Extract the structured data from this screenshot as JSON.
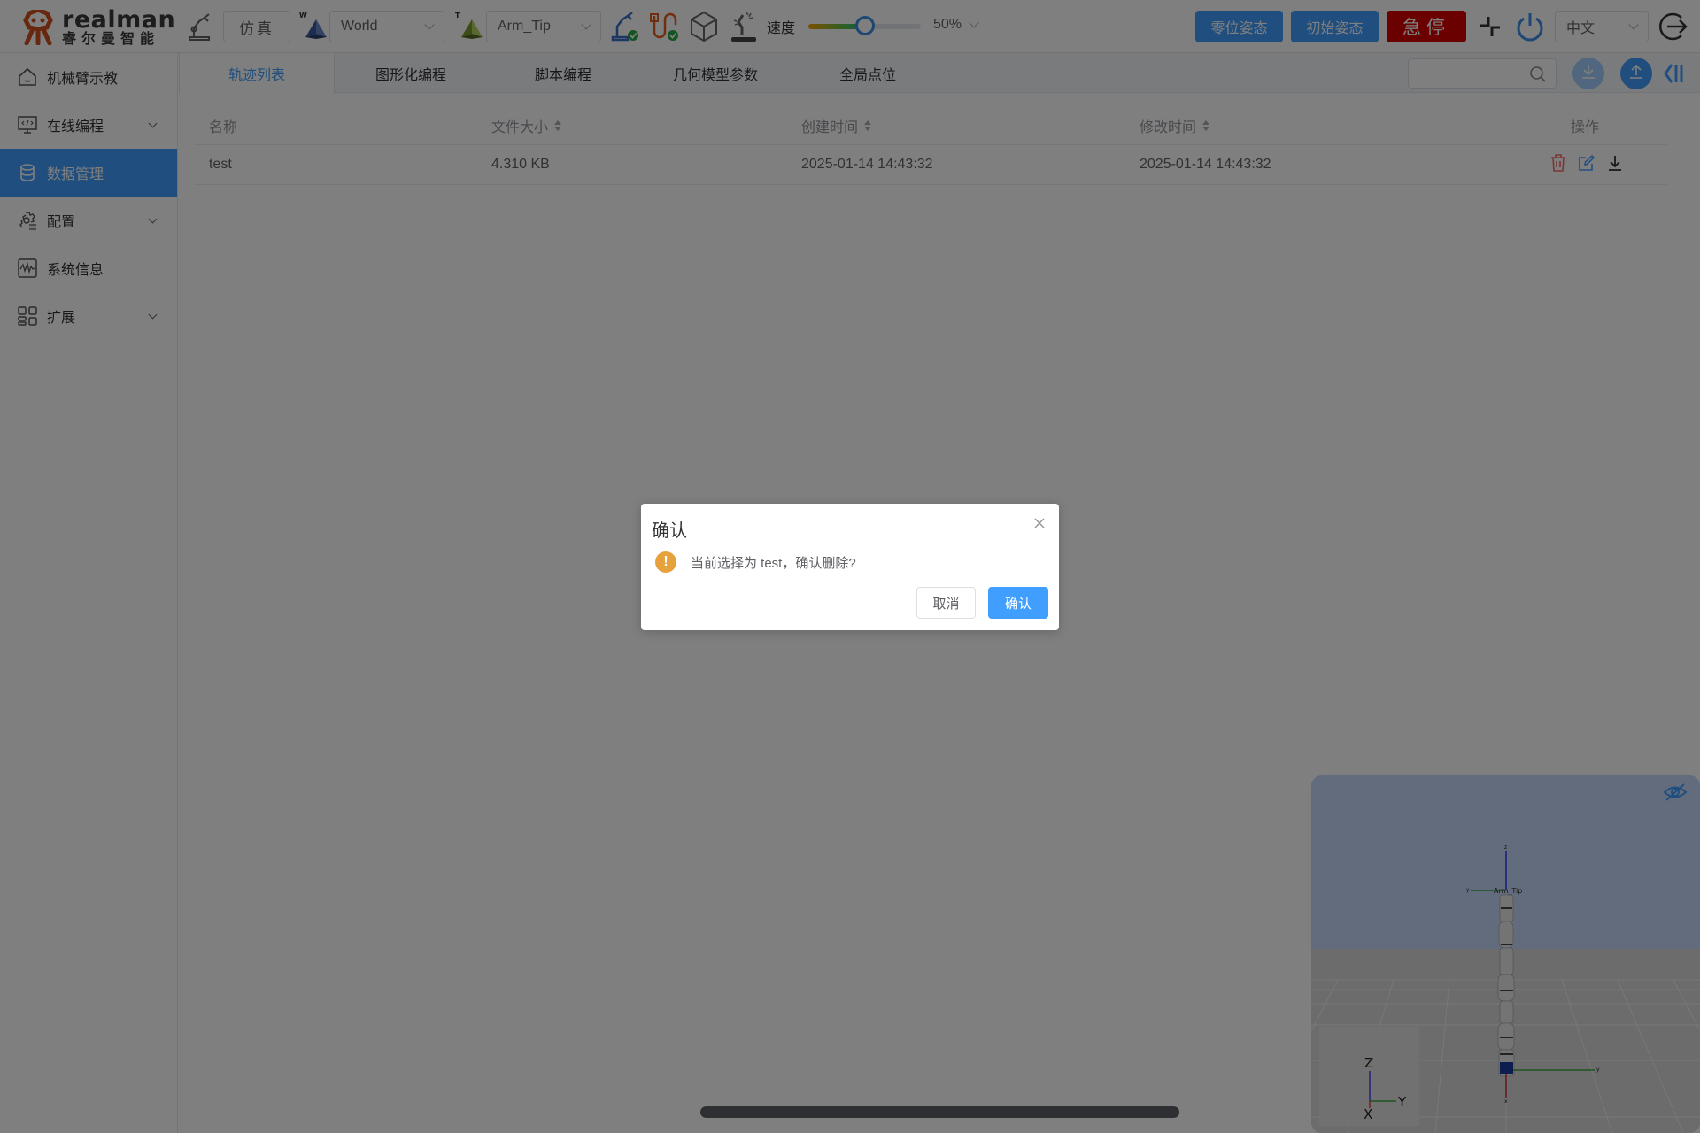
{
  "app": {
    "logo_en": "realman",
    "logo_cn": "睿尔曼智能"
  },
  "toolbar": {
    "mode_button": "仿真",
    "work_frame": {
      "label_letter": "W",
      "value": "World"
    },
    "tool_frame": {
      "label_letter": "T",
      "value": "Arm_Tip"
    },
    "speed_label": "速度",
    "speed_value": "50%",
    "speed_fraction": 0.5,
    "zero_pose_button": "零位姿态",
    "init_pose_button": "初始姿态",
    "estop_button": "急停",
    "language": "中文",
    "icons": [
      "robot-arm-icon",
      "arm-connected-icon",
      "io-connected-icon",
      "cube-model-icon",
      "teach-mode-icon",
      "collapse-icon",
      "power-icon",
      "logout-icon"
    ]
  },
  "sidebar": {
    "items": [
      {
        "label": "机械臂示教",
        "icon": "home-icon",
        "expandable": false,
        "active": false
      },
      {
        "label": "在线编程",
        "icon": "code-monitor-icon",
        "expandable": true,
        "active": false
      },
      {
        "label": "数据管理",
        "icon": "database-icon",
        "expandable": false,
        "active": true
      },
      {
        "label": "配置",
        "icon": "settings-icon",
        "expandable": true,
        "active": false
      },
      {
        "label": "系统信息",
        "icon": "pulse-icon",
        "expandable": false,
        "active": false
      },
      {
        "label": "扩展",
        "icon": "grid-icon",
        "expandable": true,
        "active": false
      }
    ]
  },
  "tabs": [
    {
      "label": "轨迹列表",
      "active": true
    },
    {
      "label": "图形化编程",
      "active": false
    },
    {
      "label": "脚本编程",
      "active": false
    },
    {
      "label": "几何模型参数",
      "active": false
    },
    {
      "label": "全局点位",
      "active": false
    }
  ],
  "search": {
    "placeholder": "",
    "value": ""
  },
  "table": {
    "columns": [
      {
        "label": "名称",
        "sortable": false
      },
      {
        "label": "文件大小",
        "sortable": true
      },
      {
        "label": "创建时间",
        "sortable": true
      },
      {
        "label": "修改时间",
        "sortable": true
      },
      {
        "label": "操作",
        "sortable": false
      }
    ],
    "rows": [
      {
        "name": "test",
        "size": "4.310 KB",
        "created": "2025-01-14 14:43:32",
        "modified": "2025-01-14 14:43:32"
      }
    ]
  },
  "viewer": {
    "tip_label": "Arm_Tip",
    "axes": {
      "x": "X",
      "y": "Y",
      "z": "Z"
    }
  },
  "dialog": {
    "title": "确认",
    "message": "当前选择为 test，确认删除?",
    "cancel": "取消",
    "confirm": "确认"
  },
  "colors": {
    "primary": "#409eff",
    "danger": "#d40000",
    "warning": "#e6a23c",
    "delete_icon": "#f56c6c"
  }
}
